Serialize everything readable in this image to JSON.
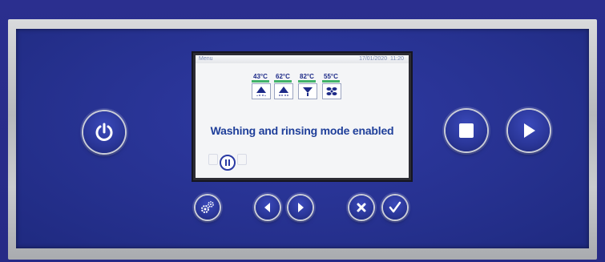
{
  "screen": {
    "menu_label": "Menu",
    "date": "17/01/2020",
    "time": "11:20",
    "message": "Washing and rinsing mode enabled",
    "temperatures": [
      {
        "label": "43°C",
        "icon": "wash-arm-icon"
      },
      {
        "label": "62°C",
        "icon": "wash-arm-icon"
      },
      {
        "label": "82°C",
        "icon": "rinse-icon"
      },
      {
        "label": "55°C",
        "icon": "fan-icon"
      }
    ]
  },
  "buttons": {
    "power": "power-icon",
    "stop": "stop-icon",
    "play": "play-icon",
    "settings": "gears-icon",
    "prev": "chevron-left-icon",
    "next": "chevron-right-icon",
    "cancel": "close-icon",
    "confirm": "check-icon"
  },
  "colors": {
    "panel": "#26318f",
    "accent_green": "#43b36a",
    "message_blue": "#1f3f9a"
  }
}
